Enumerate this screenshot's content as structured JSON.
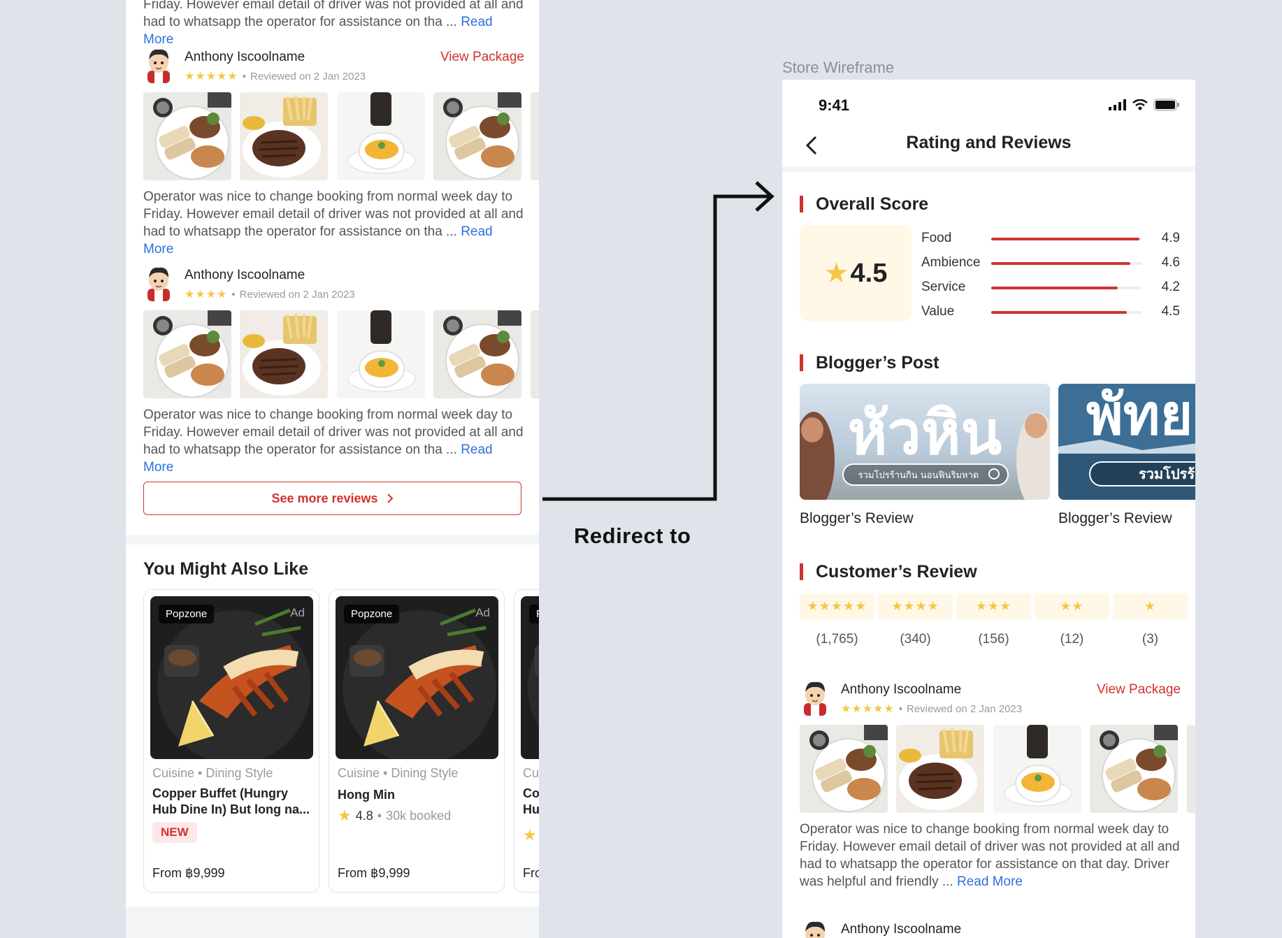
{
  "left": {
    "top_snippet": {
      "line1": "Friday. However email detail of driver was not provided at all and",
      "line2": "had to whatsapp the operator for assistance on tha ...",
      "read_more": "Read More"
    },
    "reviews": [
      {
        "name": "Anthony Iscoolname",
        "stars": "★★★★★",
        "reviewed": "Reviewed on 2 Jan 2023",
        "view_package": "View Package",
        "text": "Operator was nice to change booking from normal week day to Friday. However email detail of driver was not provided at all and had to whatsapp the operator for assistance on tha ...",
        "read_more": "Read More"
      },
      {
        "name": "Anthony Iscoolname",
        "stars": "★★★★",
        "reviewed": "Reviewed on 2 Jan 2023",
        "text": "Operator was nice to change booking from normal week day to Friday. However email detail of driver was not provided at all and had to whatsapp the operator for assistance on tha ...",
        "read_more": "Read More"
      }
    ],
    "see_more": "See more reviews",
    "you_might_also_like": "You Might Also Like",
    "products": [
      {
        "brand": "Popzone",
        "ad": "Ad",
        "category": "Cuisine • Dining Style",
        "name": "Copper Buffet (Hungry Hub Dine In) But long na...",
        "badge": "NEW",
        "price": "From ฿9,999"
      },
      {
        "brand": "Popzone",
        "ad": "Ad",
        "category": "Cuisine • Dining Style",
        "name": "Hong Min",
        "rating": "4.8",
        "booked": "30k booked",
        "price": "From ฿9,999"
      },
      {
        "brand": "P",
        "category": "Cu",
        "name": "Co Hu",
        "price": "Fro"
      }
    ]
  },
  "redirect_label": "Redirect to",
  "right": {
    "frame_label": "Store Wireframe",
    "status_time": "9:41",
    "title": "Rating and Reviews",
    "overall_score_title": "Overall Score",
    "overall_score": "4.5",
    "metrics": [
      {
        "label": "Food",
        "value": "4.9",
        "fraction": 0.98
      },
      {
        "label": "Ambience",
        "value": "4.6",
        "fraction": 0.92
      },
      {
        "label": "Service",
        "value": "4.2",
        "fraction": 0.84
      },
      {
        "label": "Value",
        "value": "4.5",
        "fraction": 0.9
      }
    ],
    "blogger_title": "Blogger’s Post",
    "blog_posts": [
      {
        "thai_title": "หัวหิน",
        "thai_sub": "รวมโปรร้านกิน นอนฟินริมหาด",
        "caption": "Blogger’s Review"
      },
      {
        "thai_title": "พัทย",
        "thai_sub": "รวมโปรร้",
        "caption": "Blogger’s Review"
      }
    ],
    "customer_title": "Customer’s Review",
    "star_filters": [
      {
        "stars": "★★★★★",
        "count": "(1,765)"
      },
      {
        "stars": "★★★★",
        "count": "(340)"
      },
      {
        "stars": "★★★",
        "count": "(156)"
      },
      {
        "stars": "★★",
        "count": "(12)"
      },
      {
        "stars": "★",
        "count": "(3)"
      }
    ],
    "review": {
      "name": "Anthony Iscoolname",
      "stars": "★★★★★",
      "reviewed": "Reviewed on 2 Jan 2023",
      "view_package": "View Package",
      "text": "Operator was nice to change booking from normal week day to Friday. However email detail of driver was not provided at all and had to whatsapp the operator for assistance on that day. Driver was helpful and friendly ...",
      "read_more": "Read More"
    },
    "next_reviewer": "Anthony Iscoolname"
  },
  "colors": {
    "accent_red": "#d1322e",
    "star_yellow": "#f6c744",
    "link_blue": "#2f6fe0",
    "canvas": "#dfe3ea"
  }
}
